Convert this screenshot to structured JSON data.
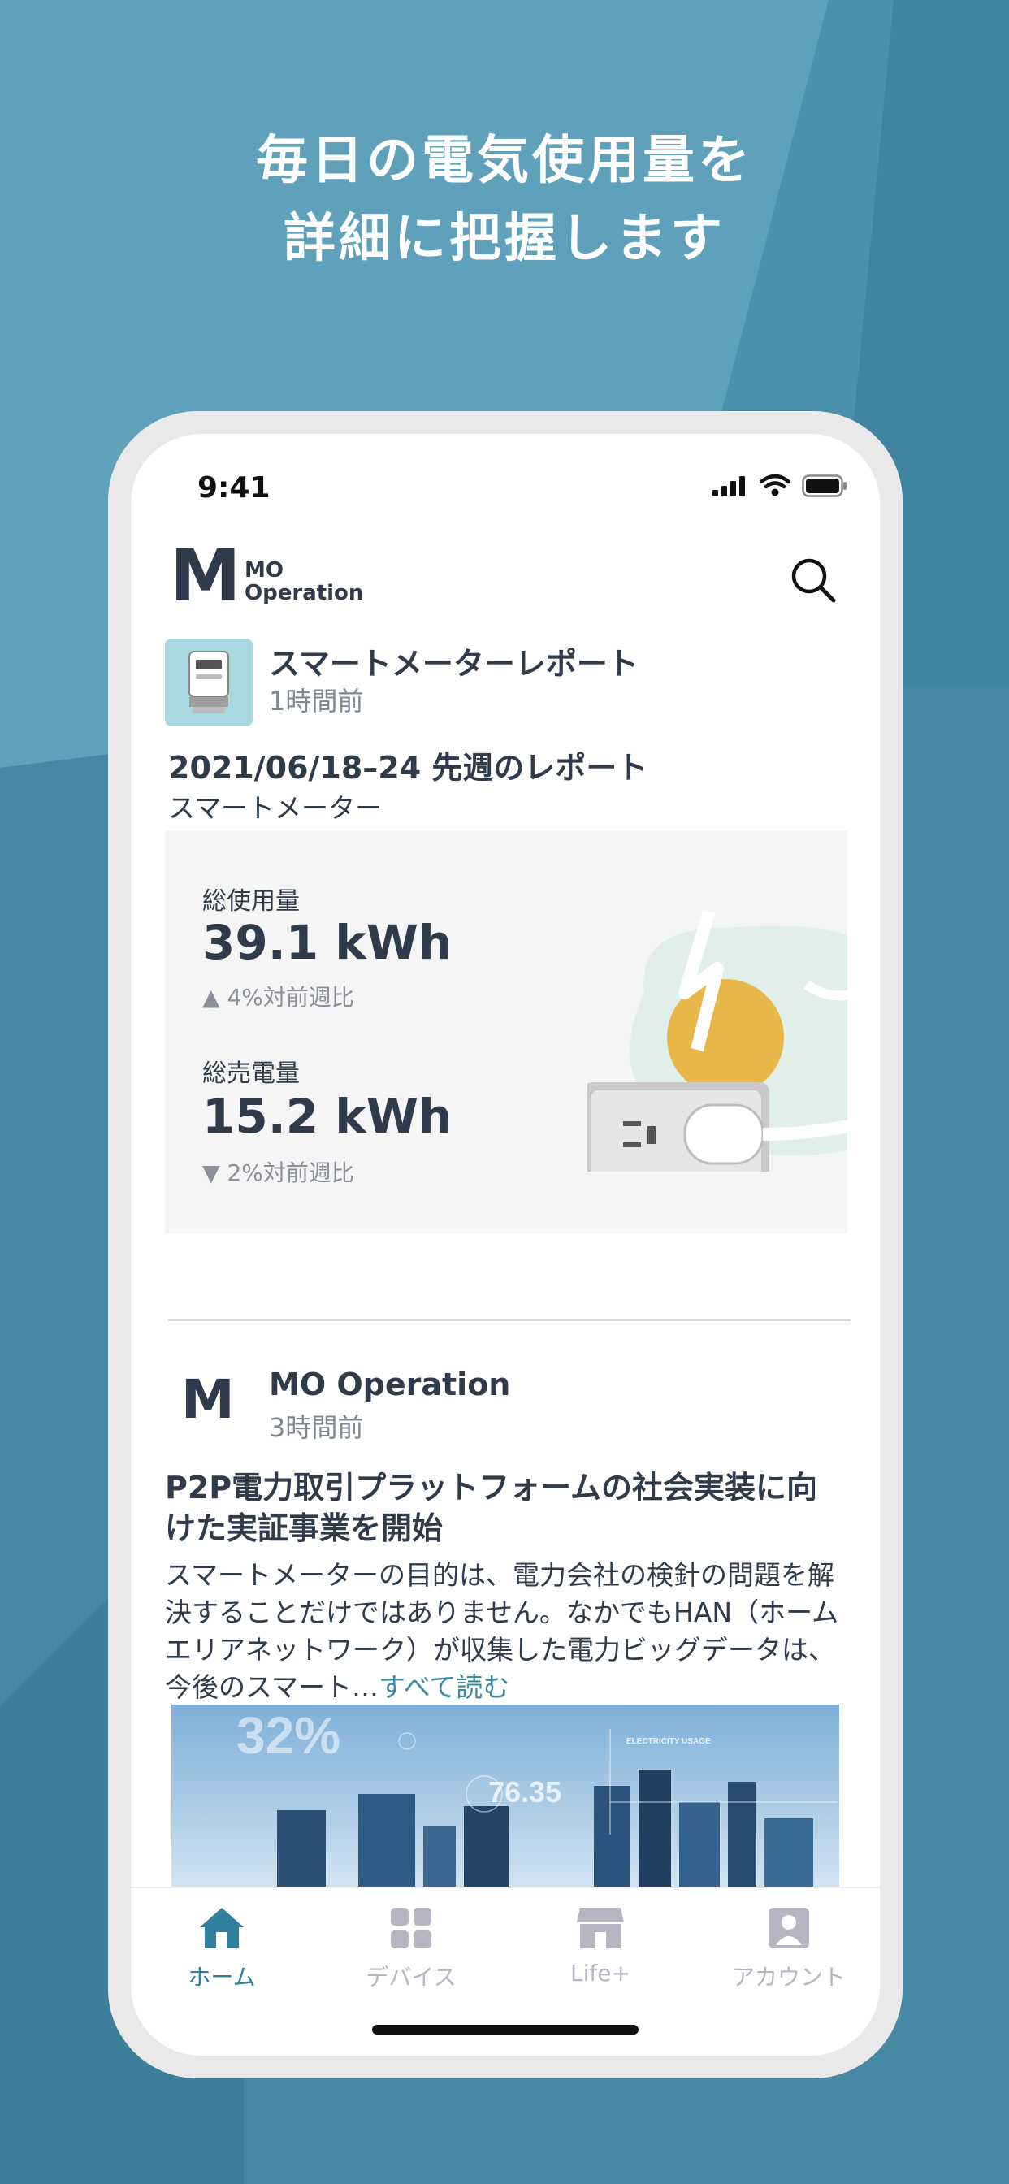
{
  "headline": {
    "line1": "毎日の電気使用量を",
    "line2": "詳細に把握します"
  },
  "status_bar": {
    "time": "9:41"
  },
  "app": {
    "logo_letter": "M",
    "logo_line1": "MO",
    "logo_line2": "Operation"
  },
  "report_post": {
    "title": "スマートメーターレポート",
    "time": "1時間前",
    "report_title": "2021/06/18–24 先週のレポート",
    "report_subtitle": "スマートメーター",
    "usage_label": "総使用量",
    "usage_value": "39.1 kWh",
    "usage_delta": "4%対前週比",
    "sold_label": "総売電量",
    "sold_value": "15.2 kWh",
    "sold_delta": "2%対前週比"
  },
  "news_post": {
    "avatar_letter": "M",
    "author": "MO Operation",
    "time": "3時間前",
    "title": "P2P電力取引プラットフォームの社会実装に向けた実証事業を開始",
    "body": "スマートメーターの目的は、電力会社の検針の問題を解決することだけではありません。なかでもHAN（ホームエリアネットワーク）が収集した電力ビッグデータは、今後のスマート…",
    "read_more": "すべて読む",
    "image_text_1": "32%",
    "image_text_2": "76.35",
    "image_text_3": "ELECTRICITY USAGE"
  },
  "tabs": [
    {
      "label": "ホーム",
      "icon": "home-icon",
      "active": true
    },
    {
      "label": "デバイス",
      "icon": "devices-icon",
      "active": false
    },
    {
      "label": "Life+",
      "icon": "store-icon",
      "active": false
    },
    {
      "label": "アカウント",
      "icon": "account-icon",
      "active": false
    }
  ],
  "colors": {
    "background": "#4a90ab",
    "accent": "#2f7f9e",
    "text": "#2f3b4a",
    "muted": "#b5b5c3"
  }
}
